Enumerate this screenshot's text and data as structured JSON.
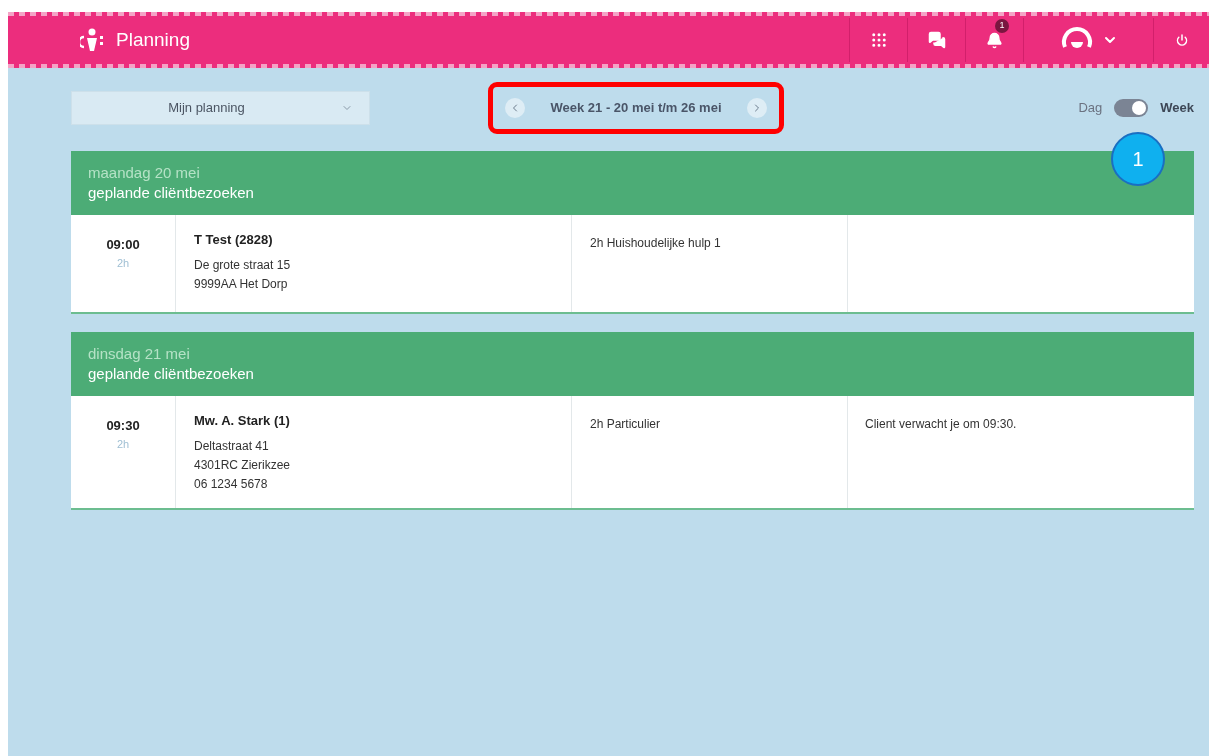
{
  "header": {
    "title": "Planning",
    "notification_count": "1"
  },
  "filter": {
    "value": "Mijn planning"
  },
  "week_nav": {
    "label": "Week 21 - 20 mei t/m 26 mei",
    "highlighted": true
  },
  "view_toggle": [
    {
      "label": "Dag",
      "selected": false
    },
    {
      "label": "Week",
      "selected": true
    }
  ],
  "callout": "1",
  "days": [
    {
      "date": "maandag 20 mei",
      "subtitle": "geplande cliëntbezoeken",
      "visits": [
        {
          "time": "09:00",
          "duration": "2h",
          "client": "T Test (2828)",
          "address": [
            "De grote straat 15",
            "9999AA Het Dorp"
          ],
          "service": "2h Huishoudelijke hulp 1"
        }
      ]
    },
    {
      "date": "dinsdag 21 mei",
      "subtitle": "geplande cliëntbezoeken",
      "visits": [
        {
          "time": "09:30",
          "duration": "2h",
          "client": "Mw. A. Stark (1)",
          "address": [
            "Deltastraat 41",
            "4301RC Zierikzee",
            "06 1234 5678"
          ],
          "service": "2h Particulier",
          "note": "Client verwacht je om 09:30."
        }
      ]
    }
  ]
}
